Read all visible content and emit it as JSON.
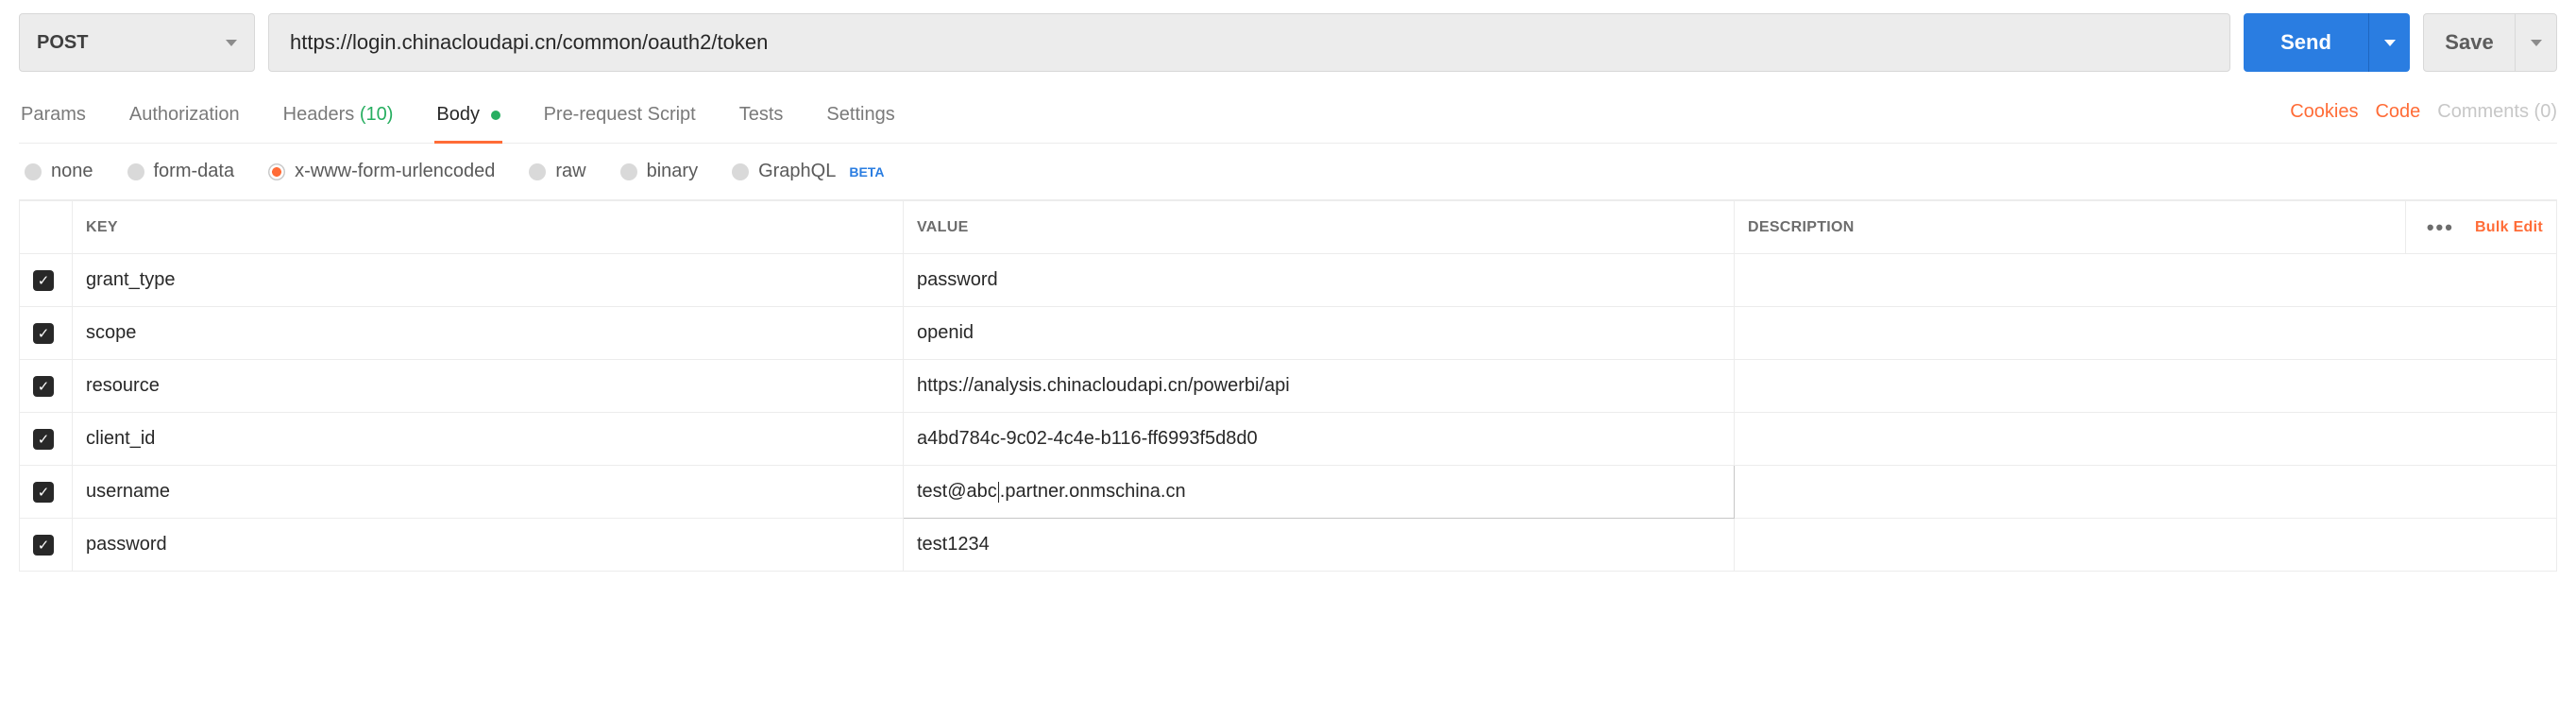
{
  "request": {
    "method": "POST",
    "url": "https://login.chinacloudapi.cn/common/oauth2/token",
    "send_label": "Send",
    "save_label": "Save"
  },
  "tabs": {
    "params": "Params",
    "authorization": "Authorization",
    "headers_label": "Headers",
    "headers_count": "(10)",
    "body": "Body",
    "prerequest": "Pre-request Script",
    "tests": "Tests",
    "settings": "Settings"
  },
  "right_links": {
    "cookies": "Cookies",
    "code": "Code",
    "comments": "Comments (0)"
  },
  "body_types": {
    "none": "none",
    "formdata": "form-data",
    "urlencoded": "x-www-form-urlencoded",
    "raw": "raw",
    "binary": "binary",
    "graphql": "GraphQL",
    "beta": "BETA"
  },
  "table": {
    "headers": {
      "key": "KEY",
      "value": "VALUE",
      "description": "DESCRIPTION"
    },
    "bulk_edit": "Bulk Edit",
    "rows": [
      {
        "checked": true,
        "key": "grant_type",
        "value": "password",
        "description": "",
        "editing": false
      },
      {
        "checked": true,
        "key": "scope",
        "value": "openid",
        "description": "",
        "editing": false
      },
      {
        "checked": true,
        "key": "resource",
        "value": "https://analysis.chinacloudapi.cn/powerbi/api",
        "description": "",
        "editing": false
      },
      {
        "checked": true,
        "key": "client_id",
        "value": "a4bd784c-9c02-4c4e-b116-ff6993f5d8d0",
        "description": "",
        "editing": false
      },
      {
        "checked": true,
        "key": "username",
        "value_pre": "test@abc",
        "value_post": ".partner.onmschina.cn",
        "description": "",
        "editing": true
      },
      {
        "checked": true,
        "key": "password",
        "value": "test1234",
        "description": "",
        "editing": false
      }
    ]
  }
}
